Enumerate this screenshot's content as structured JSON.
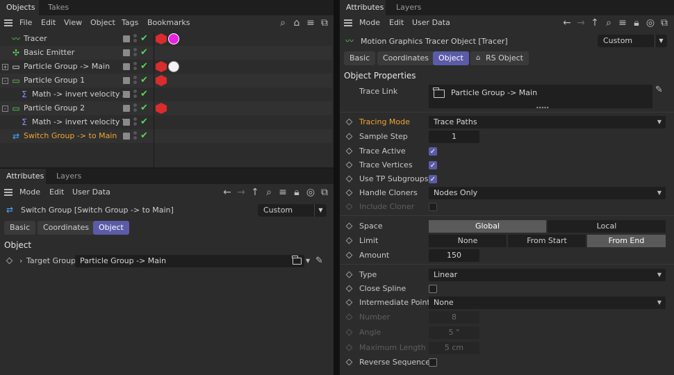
{
  "left": {
    "tabs": [
      "Objects",
      "Takes"
    ],
    "menu": [
      "File",
      "Edit",
      "View",
      "Object",
      "Tags",
      "Bookmarks"
    ],
    "objects": [
      {
        "name": "Tracer",
        "icon": "tracer-icon",
        "expander": "",
        "tags": [
          "cube-tag",
          "magenta-ball-tag"
        ]
      },
      {
        "name": "Basic Emitter",
        "icon": "emitter-icon",
        "expander": "",
        "tags": []
      },
      {
        "name": "Particle Group -> Main",
        "icon": "group-icon",
        "expander": "+",
        "tags": [
          "cube-tag",
          "white-ball-tag"
        ]
      },
      {
        "name": "Particle Group 1",
        "icon": "group-icon",
        "expander": "-",
        "tags": [
          "cube-tag"
        ]
      },
      {
        "name": "Math -> invert velocity Z",
        "icon": "math-icon",
        "expander": "",
        "tags": []
      },
      {
        "name": "Particle Group 2",
        "icon": "group-icon",
        "expander": "-",
        "tags": [
          "cube-tag"
        ]
      },
      {
        "name": "Math -> invert velocity Y",
        "icon": "math-icon",
        "expander": "",
        "tags": []
      },
      {
        "name": "Switch Group -> to Main",
        "icon": "switch-icon",
        "expander": "",
        "tags": []
      }
    ],
    "attr_tabs": [
      "Attributes",
      "Layers"
    ],
    "attr_menu": [
      "Mode",
      "Edit",
      "User Data"
    ],
    "object_title": "Switch Group [Switch Group -> to Main]",
    "preset": "Custom",
    "buttons": [
      "Basic",
      "Coordinates",
      "Object"
    ],
    "section": "Object",
    "target_label": "Target Group",
    "target_value": "Particle Group -> Main"
  },
  "right": {
    "tabs": [
      "Attributes",
      "Layers"
    ],
    "menu": [
      "Mode",
      "Edit",
      "User Data"
    ],
    "object_title": "Motion Graphics Tracer Object [Tracer]",
    "preset": "Custom",
    "buttons": [
      "Basic",
      "Coordinates",
      "Object",
      "RS Object"
    ],
    "section": "Object Properties",
    "trace_link_label": "Trace Link",
    "trace_link_value": "Particle Group -> Main",
    "tracing_mode_label": "Tracing Mode",
    "tracing_mode_value": "Trace Paths",
    "sample_step_label": "Sample Step",
    "sample_step_value": "1",
    "trace_active_label": "Trace Active",
    "trace_vertices_label": "Trace Vertices",
    "use_tp_label": "Use TP Subgroups",
    "handle_cloners_label": "Handle Cloners",
    "handle_cloners_value": "Nodes Only",
    "include_cloner_label": "Include Cloner",
    "space_label": "Space",
    "space_options": [
      "Global",
      "Local"
    ],
    "limit_label": "Limit",
    "limit_options": [
      "None",
      "From Start",
      "From End"
    ],
    "amount_label": "Amount",
    "amount_value": "150",
    "type_label": "Type",
    "type_value": "Linear",
    "close_spline_label": "Close Spline",
    "intermediate_label": "Intermediate Points",
    "intermediate_value": "None",
    "number_label": "Number",
    "number_value": "8",
    "angle_label": "Angle",
    "angle_value": "5 °",
    "maxlen_label": "Maximum Length",
    "maxlen_value": "5 cm",
    "reverse_label": "Reverse Sequence"
  }
}
